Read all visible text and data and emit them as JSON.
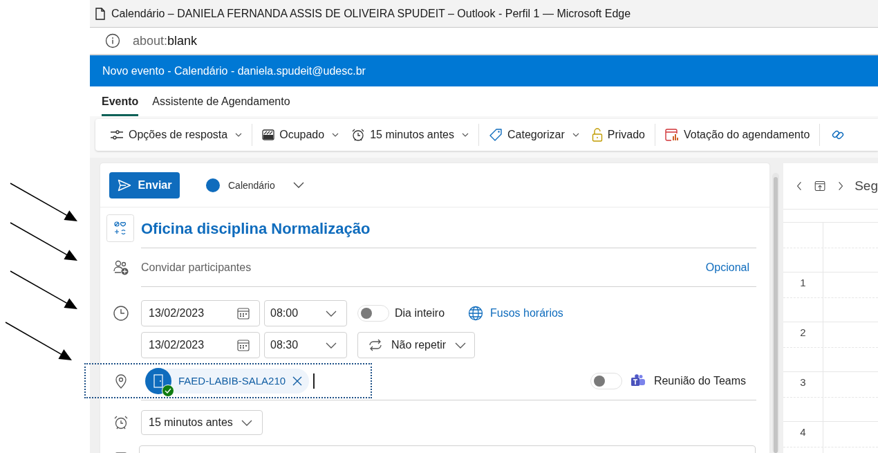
{
  "window": {
    "title": "Calendário – DANIELA FERNANDA ASSIS DE OLIVEIRA SPUDEIT – Outlook - Perfil 1 — Microsoft Edge"
  },
  "address_bar": {
    "scheme": "about:",
    "path": "blank"
  },
  "app_header": {
    "title": "Novo evento - Calendário - daniela.spudeit@udesc.br"
  },
  "tabs": [
    {
      "label": "Evento",
      "selected": true
    },
    {
      "label": "Assistente de Agendamento",
      "selected": false
    }
  ],
  "toolbar_groups": [
    [
      {
        "label": "Opções de resposta",
        "dropdown": true
      }
    ],
    [
      {
        "label": "Ocupado",
        "dropdown": true
      },
      {
        "label": "15 minutos antes",
        "dropdown": true
      }
    ],
    [
      {
        "label": "Categorizar",
        "dropdown": true
      },
      {
        "label": "Privado",
        "dropdown": false
      }
    ],
    [
      {
        "label": "Votação do agendamento",
        "dropdown": false
      }
    ]
  ],
  "send_button": "Enviar",
  "calendar_picker": "Calendário",
  "title": "Oficina disciplina Normalização",
  "attendees": {
    "placeholder": "Convidar participantes",
    "optional_link": "Opcional"
  },
  "start": {
    "date": "13/02/2023",
    "time": "08:00"
  },
  "end": {
    "date": "13/02/2023",
    "time": "08:30"
  },
  "all_day": {
    "label": "Dia inteiro",
    "on": false
  },
  "time_zones_link": "Fusos horários",
  "repeat": "Não repetir",
  "location": {
    "room": "FAED-LABIB-SALA210",
    "available": true
  },
  "teams_meeting": {
    "label": "Reunião do Teams",
    "on": false
  },
  "reminder": "15 minutos antes",
  "calendar_view": {
    "day_label": "Seg",
    "hours": [
      "1",
      "2",
      "3",
      "4"
    ]
  }
}
